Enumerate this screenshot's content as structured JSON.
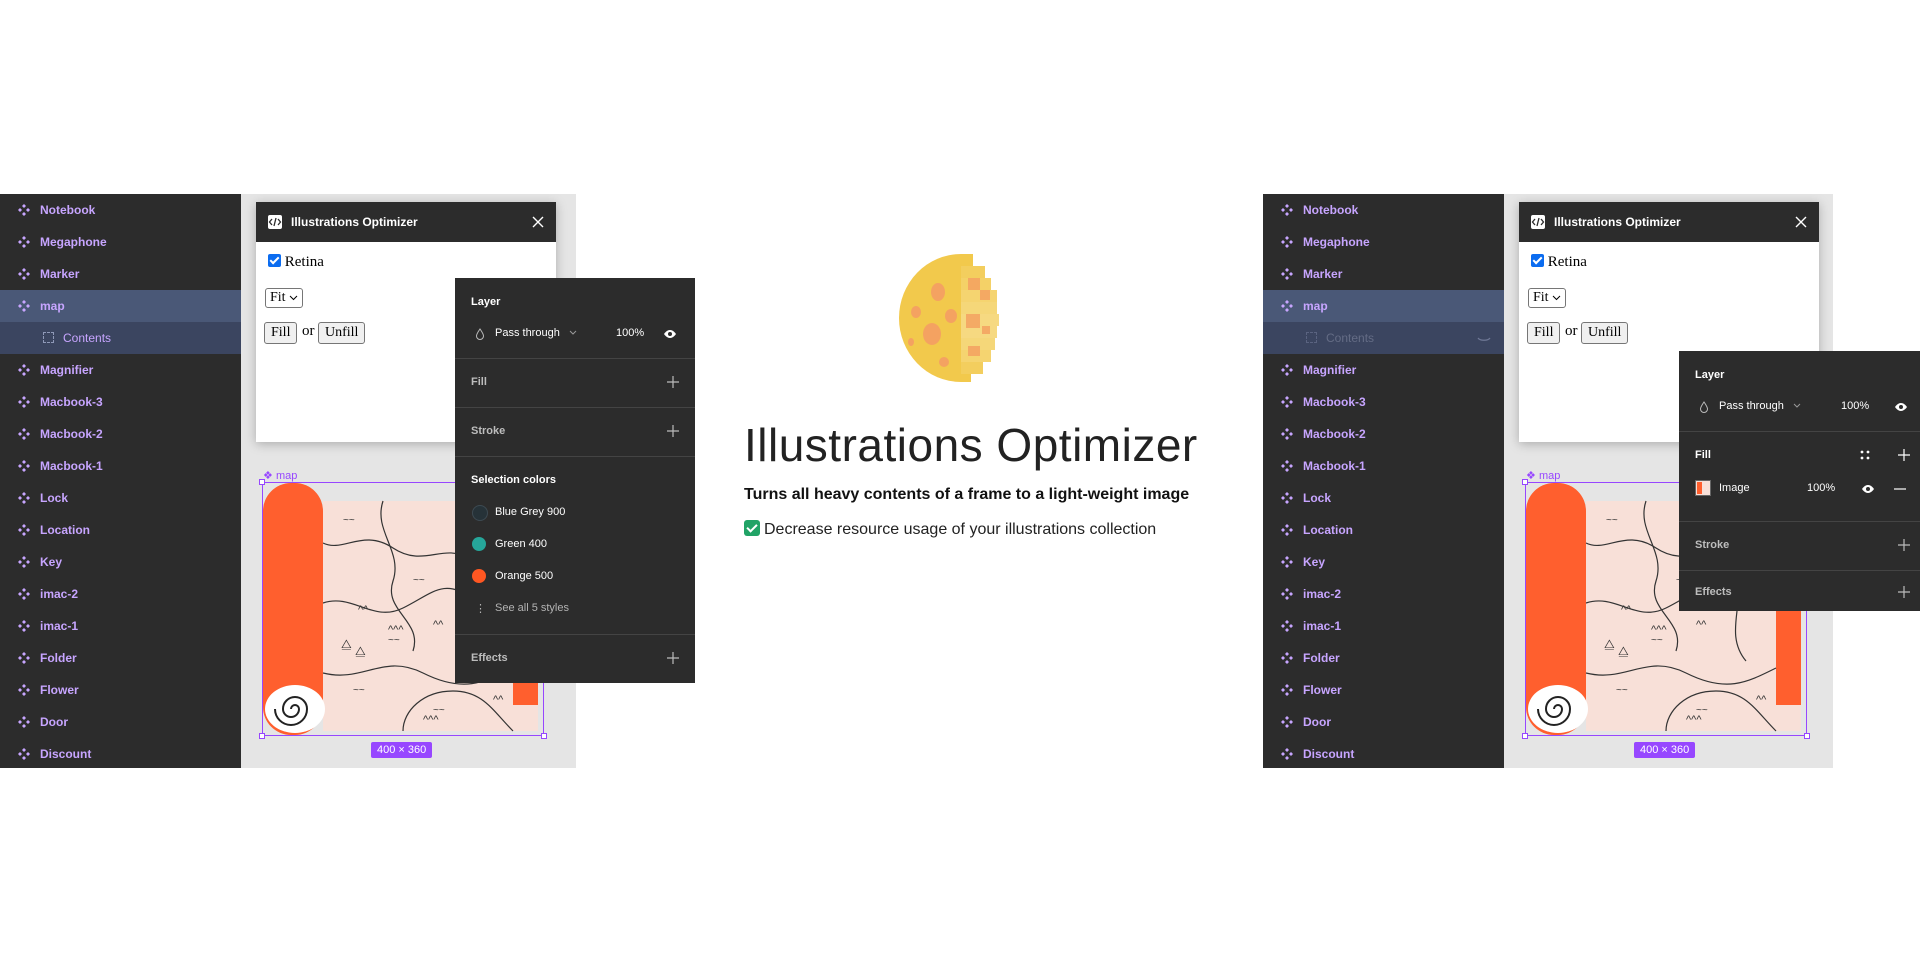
{
  "layers": [
    {
      "label": "Notebook"
    },
    {
      "label": "Megaphone"
    },
    {
      "label": "Marker"
    },
    {
      "label": "map"
    },
    {
      "label": "Contents"
    },
    {
      "label": "Magnifier"
    },
    {
      "label": "Macbook-3"
    },
    {
      "label": "Macbook-2"
    },
    {
      "label": "Macbook-1"
    },
    {
      "label": "Lock"
    },
    {
      "label": "Location"
    },
    {
      "label": "Key"
    },
    {
      "label": "imac-2"
    },
    {
      "label": "imac-1"
    },
    {
      "label": "Folder"
    },
    {
      "label": "Flower"
    },
    {
      "label": "Door"
    },
    {
      "label": "Discount"
    }
  ],
  "plugin": {
    "title": "Illustrations Optimizer",
    "retina_label": "Retina",
    "fit_option": "Fit",
    "fill_button": "Fill",
    "or_text": "or",
    "unfill_button": "Unfill"
  },
  "frame": {
    "label": "map",
    "size": "400 × 360"
  },
  "left_props": {
    "layer_title": "Layer",
    "blend_mode": "Pass through",
    "opacity": "100%",
    "fill_title": "Fill",
    "stroke_title": "Stroke",
    "selection_colors_title": "Selection colors",
    "colors": [
      {
        "name": "Blue Grey 900",
        "hex": "#263238"
      },
      {
        "name": "Green 400",
        "hex": "#26a69a"
      },
      {
        "name": "Orange 500",
        "hex": "#ff5722"
      }
    ],
    "see_all": "See all 5 styles",
    "effects_title": "Effects"
  },
  "right_props": {
    "layer_title": "Layer",
    "blend_mode": "Pass through",
    "opacity": "100%",
    "fill_title": "Fill",
    "fill_type": "Image",
    "fill_opacity": "100%",
    "stroke_title": "Stroke",
    "effects_title": "Effects"
  },
  "hero": {
    "title": "Illustrations Optimizer",
    "subtitle": "Turns all heavy contents of a frame to a light-weight image",
    "point": "Decrease resource usage of your illustrations collection"
  },
  "colors": {
    "accent": "#9747ff",
    "map_orange": "#ff5f2e",
    "map_bg": "#f8e0d8",
    "panel": "#2c2c2c",
    "layer_text": "#c7a5ff"
  }
}
